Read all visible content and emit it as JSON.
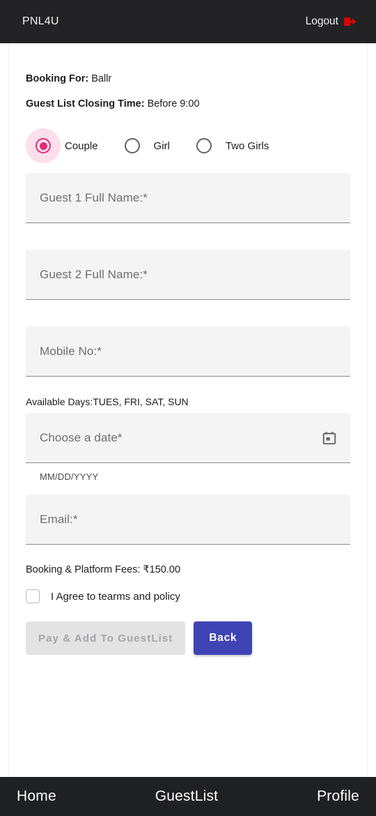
{
  "topbar": {
    "brand": "PNL4U",
    "logout_label": "Logout",
    "logout_icon": "logout-exit-icon",
    "background": "#232326",
    "logout_icon_color": "#e00000"
  },
  "booking": {
    "booking_for_label": "Booking For:",
    "booking_for_value": "Ballr",
    "closing_time_label": "Guest List Closing Time:",
    "closing_time_value": "Before 9:00"
  },
  "guest_type": {
    "selected": "Couple",
    "accent": "#e52a78",
    "options": [
      {
        "label": "Couple",
        "selected": true
      },
      {
        "label": "Girl",
        "selected": false
      },
      {
        "label": "Two Girls",
        "selected": false
      }
    ]
  },
  "fields": {
    "guest1": {
      "placeholder": "Guest 1 Full Name:*",
      "value": ""
    },
    "guest2": {
      "placeholder": "Guest 2 Full Name:*",
      "value": ""
    },
    "mobile": {
      "placeholder": "Mobile No:*",
      "value": ""
    },
    "available_days": "Available Days:TUES, FRI, SAT, SUN",
    "date": {
      "placeholder": "Choose a date*",
      "value": "",
      "hint": "MM/DD/YYYY",
      "icon": "calendar-icon"
    },
    "email": {
      "placeholder": "Email:*",
      "value": ""
    }
  },
  "fees": {
    "text": "Booking & Platform Fees: ₹150.00"
  },
  "agreement": {
    "label": "I Agree to tearms and policy",
    "checked": false
  },
  "actions": {
    "pay_label": "Pay & Add To GuestList",
    "pay_disabled": true,
    "back_label": "Back",
    "back_color": "#3f44b5"
  },
  "bottom_nav": {
    "items": [
      {
        "label": "Home"
      },
      {
        "label": "GuestList"
      },
      {
        "label": "Profile"
      }
    ]
  }
}
